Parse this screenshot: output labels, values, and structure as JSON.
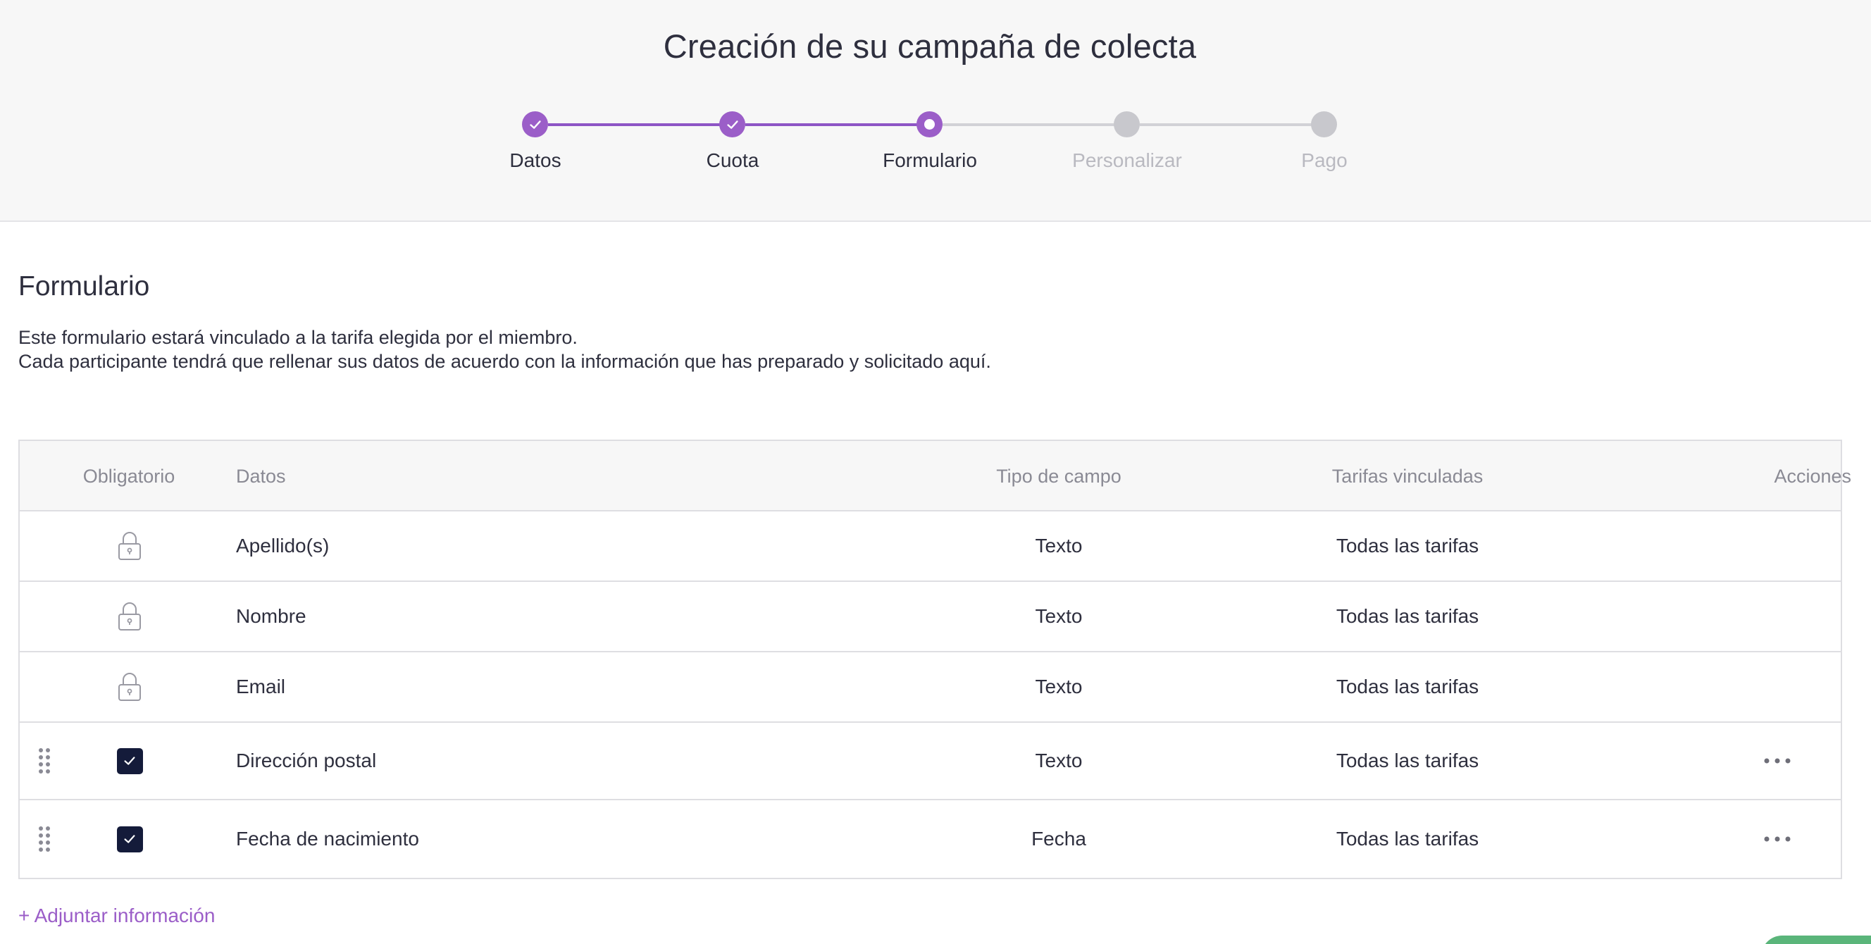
{
  "header": {
    "title": "Creación de su campaña de colecta",
    "steps": [
      {
        "label": "Datos",
        "status": "done"
      },
      {
        "label": "Cuota",
        "status": "done"
      },
      {
        "label": "Formulario",
        "status": "current"
      },
      {
        "label": "Personalizar",
        "status": "todo"
      },
      {
        "label": "Pago",
        "status": "todo"
      }
    ]
  },
  "section": {
    "title": "Formulario",
    "intro_line1": "Este formulario estará vinculado a la tarifa elegida por el miembro.",
    "intro_line2": "Cada participante tendrá que rellenar sus datos de acuerdo con la información que has preparado y solicitado aquí."
  },
  "table": {
    "columns": {
      "required": "Obligatorio",
      "data": "Datos",
      "type": "Tipo de campo",
      "rates": "Tarifas vinculadas",
      "actions": "Acciones"
    },
    "rows": [
      {
        "required": "locked",
        "data": "Apellido(s)",
        "type": "Texto",
        "rates": "Todas las tarifas"
      },
      {
        "required": "locked",
        "data": "Nombre",
        "type": "Texto",
        "rates": "Todas las tarifas"
      },
      {
        "required": "locked",
        "data": "Email",
        "type": "Texto",
        "rates": "Todas las tarifas"
      },
      {
        "required": "checked",
        "data": "Dirección postal",
        "type": "Texto",
        "rates": "Todas las tarifas"
      },
      {
        "required": "checked",
        "data": "Fecha de nacimiento",
        "type": "Fecha",
        "rates": "Todas las tarifas"
      }
    ]
  },
  "footer": {
    "add_label": "+ Adjuntar información"
  },
  "colors": {
    "accent": "#9b5ec8",
    "checkbox": "#141b3a",
    "inactive": "#c8c8cd"
  }
}
